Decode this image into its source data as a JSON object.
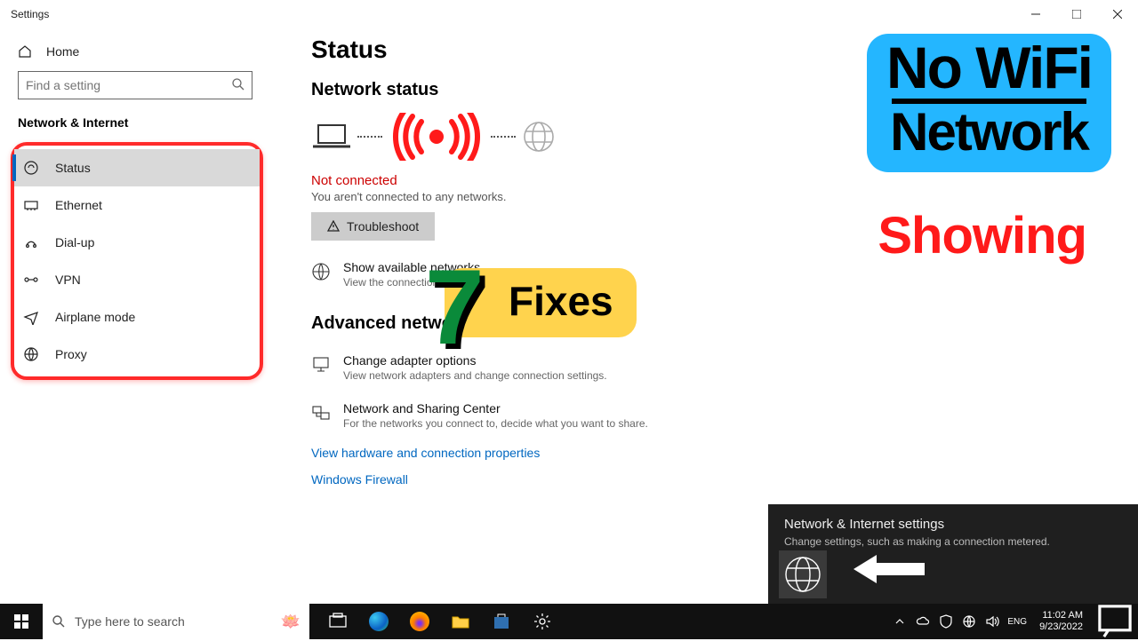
{
  "window": {
    "title": "Settings"
  },
  "sidebar": {
    "home": "Home",
    "search_placeholder": "Find a setting",
    "category": "Network & Internet",
    "items": [
      {
        "label": "Status"
      },
      {
        "label": "Ethernet"
      },
      {
        "label": "Dial-up"
      },
      {
        "label": "VPN"
      },
      {
        "label": "Airplane mode"
      },
      {
        "label": "Proxy"
      }
    ]
  },
  "main": {
    "heading": "Status",
    "section1": "Network status",
    "not_connected_title": "Not connected",
    "not_connected_sub": "You aren't connected to any networks.",
    "troubleshoot": "Troubleshoot",
    "show_networks_title": "Show available networks",
    "show_networks_sub": "View the connection options around you.",
    "section2": "Advanced network settings",
    "adapter_title": "Change adapter options",
    "adapter_sub": "View network adapters and change connection settings.",
    "sharing_title": "Network and Sharing Center",
    "sharing_sub": "For the networks you connect to, decide what you want to share.",
    "link_hw": "View hardware and connection properties",
    "link_fw": "Windows Firewall"
  },
  "overlay": {
    "badge_l1": "No WiFi",
    "badge_l2": "Network",
    "showing": "Showing",
    "fixes": "Fixes",
    "seven": "7"
  },
  "net_popup": {
    "title": "Network & Internet settings",
    "sub": "Change settings, such as making a connection metered."
  },
  "taskbar": {
    "search_placeholder": "Type here to search",
    "time": "11:02 AM",
    "date": "9/23/2022"
  }
}
